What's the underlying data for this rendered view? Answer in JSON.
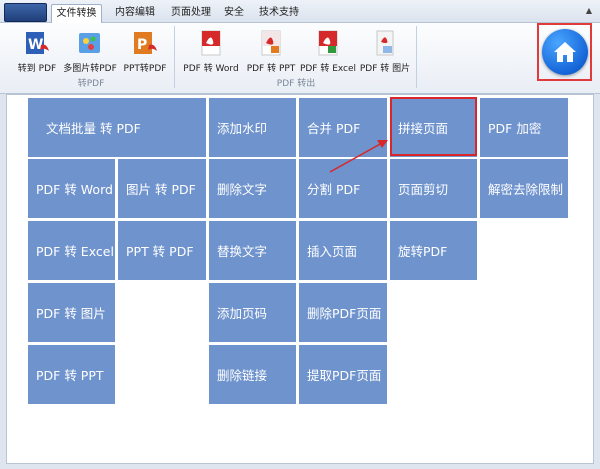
{
  "menu": {
    "tabs": [
      {
        "label": "文件转换",
        "active": true
      },
      {
        "label": "内容编辑",
        "active": false
      },
      {
        "label": "页面处理",
        "active": false
      },
      {
        "label": "安全",
        "active": false
      },
      {
        "label": "技术支持",
        "active": false
      }
    ]
  },
  "ribbon": {
    "groups": [
      {
        "label": "转PDF",
        "buttons": [
          "转到 PDF",
          "多图片转PDF",
          "PPT转PDF"
        ]
      },
      {
        "label": "PDF 转出",
        "buttons": [
          "PDF 转 Word",
          "PDF 转 PPT",
          "PDF 转 Excel",
          "PDF 转 图片"
        ]
      }
    ]
  },
  "tiles": {
    "batch_to_pdf": "文档批量 转 PDF",
    "pdf_to_word": "PDF 转 Word",
    "image_to_pdf": "图片 转 PDF",
    "pdf_to_excel": "PDF 转 Excel",
    "ppt_to_pdf": "PPT 转 PDF",
    "pdf_to_image": "PDF 转 图片",
    "pdf_to_ppt": "PDF 转 PPT",
    "add_watermark": "添加水印",
    "delete_text": "删除文字",
    "replace_text": "替换文字",
    "add_page_number": "添加页码",
    "delete_links": "删除链接",
    "merge_pdf": "合并 PDF",
    "split_pdf": "分割 PDF",
    "insert_page": "插入页面",
    "delete_pdf_page": "删除PDF页面",
    "extract_pdf_page": "提取PDF页面",
    "stitch_pages": "拼接页面",
    "crop_page": "页面剪切",
    "rotate_pdf": "旋转PDF",
    "pdf_encrypt": "PDF 加密",
    "decrypt_remove_restrictions": "解密去除限制"
  },
  "colors": {
    "tile": "#6f93cd",
    "highlight": "#d8262b",
    "home": "#1565d8"
  },
  "icons": {
    "home": "home-icon"
  }
}
